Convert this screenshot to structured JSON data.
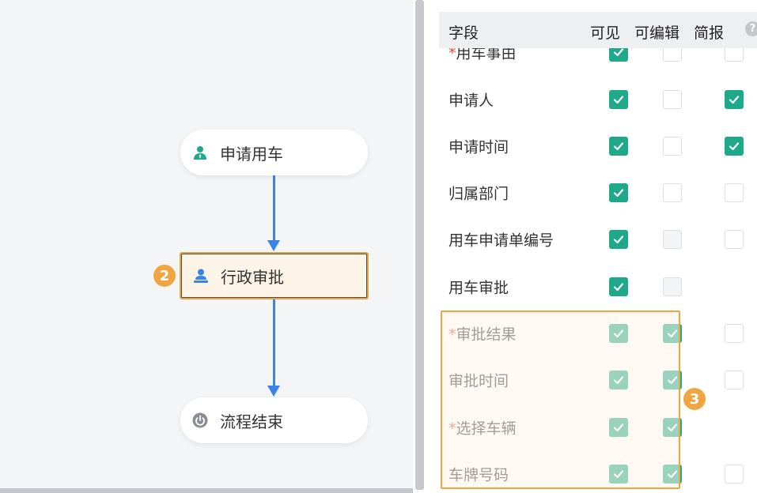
{
  "flow": {
    "nodes": [
      {
        "label": "申请用车",
        "icon": "user-applicant-icon"
      },
      {
        "label": "行政审批",
        "icon": "user-approver-icon"
      },
      {
        "label": "流程结束",
        "icon": "power-end-icon"
      }
    ],
    "step_badge": "2"
  },
  "table": {
    "headers": {
      "field": "字段",
      "visible": "可见",
      "editable": "可编辑",
      "brief": "简报"
    },
    "help_icon": "?",
    "rows": [
      {
        "required_mark": "*",
        "label": "用车事由",
        "visible": "on",
        "editable": "off",
        "brief": "off"
      },
      {
        "required_mark": "",
        "label": "申请人",
        "visible": "on",
        "editable": "off",
        "brief": "on"
      },
      {
        "required_mark": "",
        "label": "申请时间",
        "visible": "on",
        "editable": "off",
        "brief": "on"
      },
      {
        "required_mark": "",
        "label": "归属部门",
        "visible": "on",
        "editable": "off",
        "brief": "off"
      },
      {
        "required_mark": "",
        "label": "用车申请单编号",
        "visible": "on",
        "editable": "disabled",
        "brief": "off"
      },
      {
        "required_mark": "",
        "label": "用车审批",
        "visible": "on",
        "editable": "disabled",
        "brief": "none"
      },
      {
        "required_mark": "*",
        "label": "审批结果",
        "visible": "on",
        "editable": "on",
        "brief": "off"
      },
      {
        "required_mark": "",
        "label": "审批时间",
        "visible": "on",
        "editable": "on",
        "brief": "off"
      },
      {
        "required_mark": "*",
        "label": "选择车辆",
        "visible": "on",
        "editable": "on",
        "brief": "none"
      },
      {
        "required_mark": "",
        "label": "车牌号码",
        "visible": "on",
        "editable": "on",
        "brief": "off"
      }
    ],
    "highlight_badge": "3"
  },
  "colors": {
    "accent_green": "#1fa88a",
    "flow_blue": "#3a84e8",
    "highlight_orange": "#efa641",
    "required_red": "#e04a3f"
  }
}
